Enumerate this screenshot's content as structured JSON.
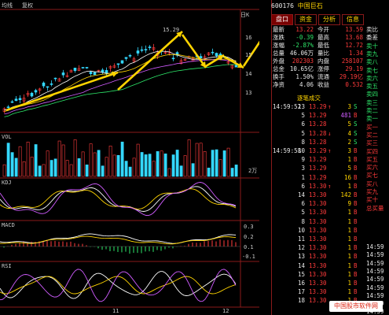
{
  "stock": {
    "code": "600176",
    "name": "中国巨石"
  },
  "top_left": {
    "label1": "均线",
    "label2": "复权",
    "right_tag": "日K"
  },
  "chart": {
    "high_label": "15.29",
    "price_axis": [
      "16",
      "15",
      "14",
      "13"
    ],
    "date_labels": [
      "11",
      "12"
    ],
    "vol_axis": [
      "2万"
    ],
    "macd_axis": [
      "0.3",
      "0.2",
      "0.1",
      "-0.1",
      "-0.2",
      "-0.3"
    ]
  },
  "indicators": {
    "vol": "VOL",
    "kdj": "KDJ",
    "macd": "MACD",
    "rsi": "RSI"
  },
  "tabs": [
    "盘口",
    "资金",
    "分析",
    "信息"
  ],
  "quote": [
    {
      "k": "最新",
      "v": "13.22",
      "k2": "今开",
      "v2": "13.59",
      "c": "red"
    },
    {
      "k": "涨跌",
      "v": "-0.39",
      "k2": "最高",
      "v2": "13.68",
      "c": "grn"
    },
    {
      "k": "涨幅",
      "v": "-2.87%",
      "k2": "最低",
      "v2": "12.72",
      "c": "grn"
    },
    {
      "k": "总量",
      "v": "46.06万",
      "k2": "量比",
      "v2": "1.34",
      "c": "wht"
    },
    {
      "k": "外盘",
      "v": "202303",
      "k2": "内盘",
      "v2": "258107",
      "c": "red"
    },
    {
      "k": "总金",
      "v": "10.65亿",
      "k2": "涨停",
      "v2": "29.19",
      "c": "wht"
    },
    {
      "k": "换手",
      "v": "1.50%",
      "k2": "流通",
      "v2": "29.19亿",
      "c": "wht"
    },
    {
      "k": "净资",
      "v": "4.06",
      "k2": "收益",
      "v2": "0.532",
      "c": "wht"
    }
  ],
  "trade_title": "逐笔成交",
  "trades": [
    {
      "t": "14:59:52",
      "n": "13",
      "p": "13.29",
      "a": "↑",
      "v": "3",
      "s": "S"
    },
    {
      "t": "",
      "n": "5",
      "p": "13.29",
      "a": "",
      "v": "481",
      "s": "B"
    },
    {
      "t": "",
      "n": "6",
      "p": "13.28",
      "a": "",
      "v": "5",
      "s": "S"
    },
    {
      "t": "",
      "n": "5",
      "p": "13.28",
      "a": "↓",
      "v": "4",
      "s": "S"
    },
    {
      "t": "",
      "n": "8",
      "p": "13.28",
      "a": "",
      "v": "2",
      "s": "S"
    },
    {
      "t": "14:59:58",
      "n": "10",
      "p": "13.29",
      "a": "↑",
      "v": "3",
      "s": "B"
    },
    {
      "t": "",
      "n": "9",
      "p": "13.29",
      "a": "",
      "v": "1",
      "s": "B"
    },
    {
      "t": "",
      "n": "3",
      "p": "13.29",
      "a": "",
      "v": "5",
      "s": "B"
    },
    {
      "t": "",
      "n": "1",
      "p": "13.29",
      "a": "",
      "v": "16",
      "s": "B"
    },
    {
      "t": "",
      "n": "6",
      "p": "13.30",
      "a": "↑",
      "v": "1",
      "s": "B"
    },
    {
      "t": "",
      "n": "14",
      "p": "13.30",
      "a": "",
      "v": "142",
      "s": "B"
    },
    {
      "t": "",
      "n": "6",
      "p": "13.30",
      "a": "",
      "v": "9",
      "s": "B"
    },
    {
      "t": "",
      "n": "5",
      "p": "13.30",
      "a": "",
      "v": "1",
      "s": "B"
    },
    {
      "t": "",
      "n": "8",
      "p": "13.30",
      "a": "",
      "v": "1",
      "s": "B"
    },
    {
      "t": "",
      "n": "10",
      "p": "13.30",
      "a": "",
      "v": "1",
      "s": "B"
    },
    {
      "t": "",
      "n": "11",
      "p": "13.30",
      "a": "",
      "v": "1",
      "s": "B"
    },
    {
      "t": "",
      "n": "12",
      "p": "13.30",
      "a": "",
      "v": "1",
      "s": "B"
    },
    {
      "t": "",
      "n": "13",
      "p": "13.30",
      "a": "",
      "v": "1",
      "s": "B"
    },
    {
      "t": "",
      "n": "14",
      "p": "13.30",
      "a": "",
      "v": "1",
      "s": "B"
    },
    {
      "t": "",
      "n": "15",
      "p": "13.30",
      "a": "",
      "v": "1",
      "s": "B"
    },
    {
      "t": "",
      "n": "16",
      "p": "13.30",
      "a": "",
      "v": "1",
      "s": "B"
    },
    {
      "t": "",
      "n": "17",
      "p": "13.30",
      "a": "",
      "v": "1",
      "s": "B"
    },
    {
      "t": "",
      "n": "18",
      "p": "13.30",
      "a": "",
      "v": "1",
      "s": "B"
    }
  ],
  "side_labels": [
    "卖比",
    "委差",
    "卖十",
    "卖九",
    "卖八",
    "卖七",
    "卖六",
    "卖五",
    "卖四",
    "卖三",
    "卖二",
    "卖一",
    "买一",
    "买二",
    "买三",
    "买四",
    "买五",
    "买六",
    "买七",
    "买八",
    "买九",
    "买十",
    "总买量"
  ],
  "side_times": [
    "14:59",
    "14:59",
    "14:59",
    "14:59",
    "14:59",
    "14:59",
    "14:59",
    "14:59",
    "14:59"
  ],
  "watermark": "中国股市软件网",
  "colors": {
    "up": "#ff3b3b",
    "down": "#2ee86a",
    "accent": "#ffd400",
    "border": "#8a1a1a"
  }
}
